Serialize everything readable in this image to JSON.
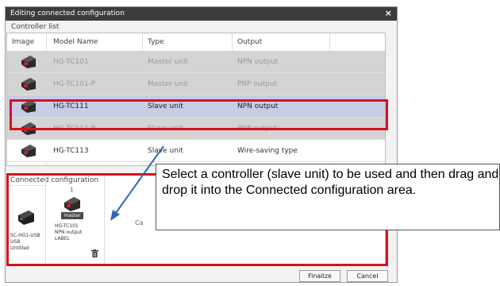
{
  "window": {
    "title": "Editing connected configuration",
    "close_glyph": "×"
  },
  "controller_list": {
    "label": "Controller list",
    "columns": [
      "Image",
      "Model Name",
      "Type",
      "Output"
    ],
    "rows": [
      {
        "model": "HG-TC101",
        "type": "Master unit",
        "output": "NPN output",
        "state": "grey"
      },
      {
        "model": "HG-TC101-P",
        "type": "Master unit",
        "output": "PNP output",
        "state": "grey"
      },
      {
        "model": "HG-TC111",
        "type": "Slave unit",
        "output": "NPN output",
        "state": "selected"
      },
      {
        "model": "HG-TC111-P",
        "type": "Slave unit",
        "output": "PNP output",
        "state": "grey"
      },
      {
        "model": "HG-TC113",
        "type": "Slave unit",
        "output": "Wire-saving type",
        "state": "normal"
      }
    ]
  },
  "connected_configuration": {
    "label": "Connected configuration",
    "slot_number": "1",
    "usb_node": {
      "line1": "SC-HG1-USB",
      "line2": "USB",
      "line3": "Untitled"
    },
    "master_node": {
      "badge": "master",
      "line1": "HG-TC101",
      "line2": "NPN output",
      "line3": "LABEL"
    },
    "hidden_text": "Ca"
  },
  "buttons": {
    "finalize": "Finalize",
    "cancel": "Cancel"
  },
  "callout": {
    "text": "Select a controller (slave unit) to be used and then drag and drop it into the Connected configuration area."
  },
  "colors": {
    "highlight": "#d5121f",
    "selected_row": "#c8cde6",
    "arrow": "#2f67b3"
  }
}
